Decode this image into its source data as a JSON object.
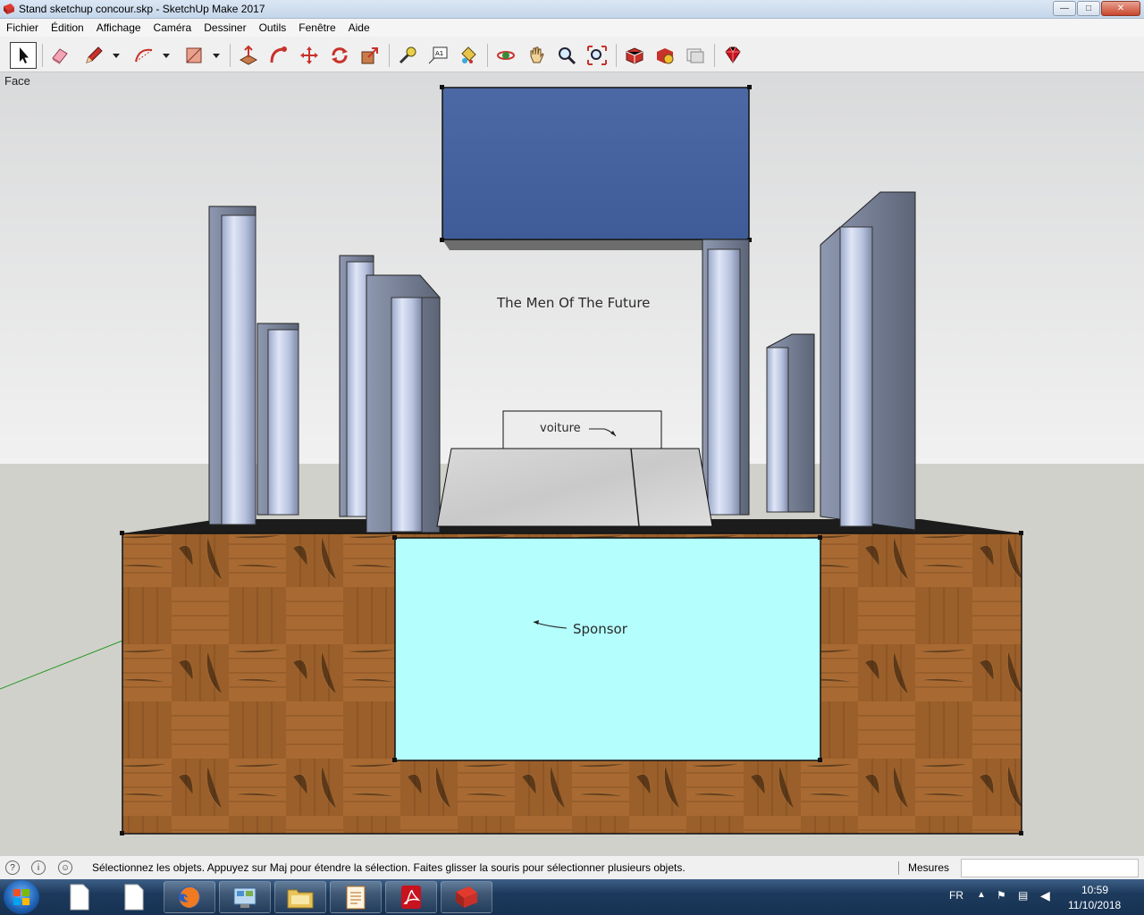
{
  "window": {
    "title": "Stand sketchup concour.skp - SketchUp Make 2017",
    "buttons": [
      "minimize",
      "maximize",
      "close"
    ]
  },
  "menu": [
    "Fichier",
    "Édition",
    "Affichage",
    "Caméra",
    "Dessiner",
    "Outils",
    "Fenêtre",
    "Aide"
  ],
  "toolbar": {
    "tools": [
      "select-tool",
      "eraser-tool",
      "pencil-tool",
      "arc-tool",
      "rectangle-tool",
      "push-pull-tool",
      "follow-me-tool",
      "move-tool",
      "rotate-tool",
      "scale-tool",
      "tape-measure-tool",
      "text-tool",
      "paint-bucket-tool",
      "orbit-tool",
      "pan-tool",
      "zoom-tool",
      "zoom-extents-tool",
      "3d-warehouse-tool",
      "extension-warehouse-tool",
      "layout-tool",
      "ruby-extension-tool"
    ],
    "text_tool_glyph": "A1"
  },
  "viewport": {
    "view_name": "Face",
    "labels": {
      "banner_text": "The Men Of The Future",
      "car_label": "voiture",
      "sponsor_label": "Sponsor"
    },
    "colors": {
      "sky": "#e9e9e9",
      "ground": "#d2d2cc",
      "banner": "#4a6aa8",
      "sponsor_panel": "#b4fffe",
      "wood": "#a0622a",
      "axis_green": "#2a9a2a"
    }
  },
  "statusbar": {
    "message": "Sélectionnez les objets. Appuyez sur Maj pour étendre la sélection. Faites glisser la souris pour sélectionner plusieurs objets.",
    "measure_label": "Mesures",
    "measure_value": ""
  },
  "taskbar": {
    "apps": [
      "start-button",
      "blank-document-1",
      "blank-document-2",
      "firefox",
      "control-panel",
      "file-explorer",
      "notepad-editor",
      "adobe-reader",
      "sketchup"
    ],
    "language": "FR",
    "time": "10:59",
    "date": "11/10/2018"
  }
}
